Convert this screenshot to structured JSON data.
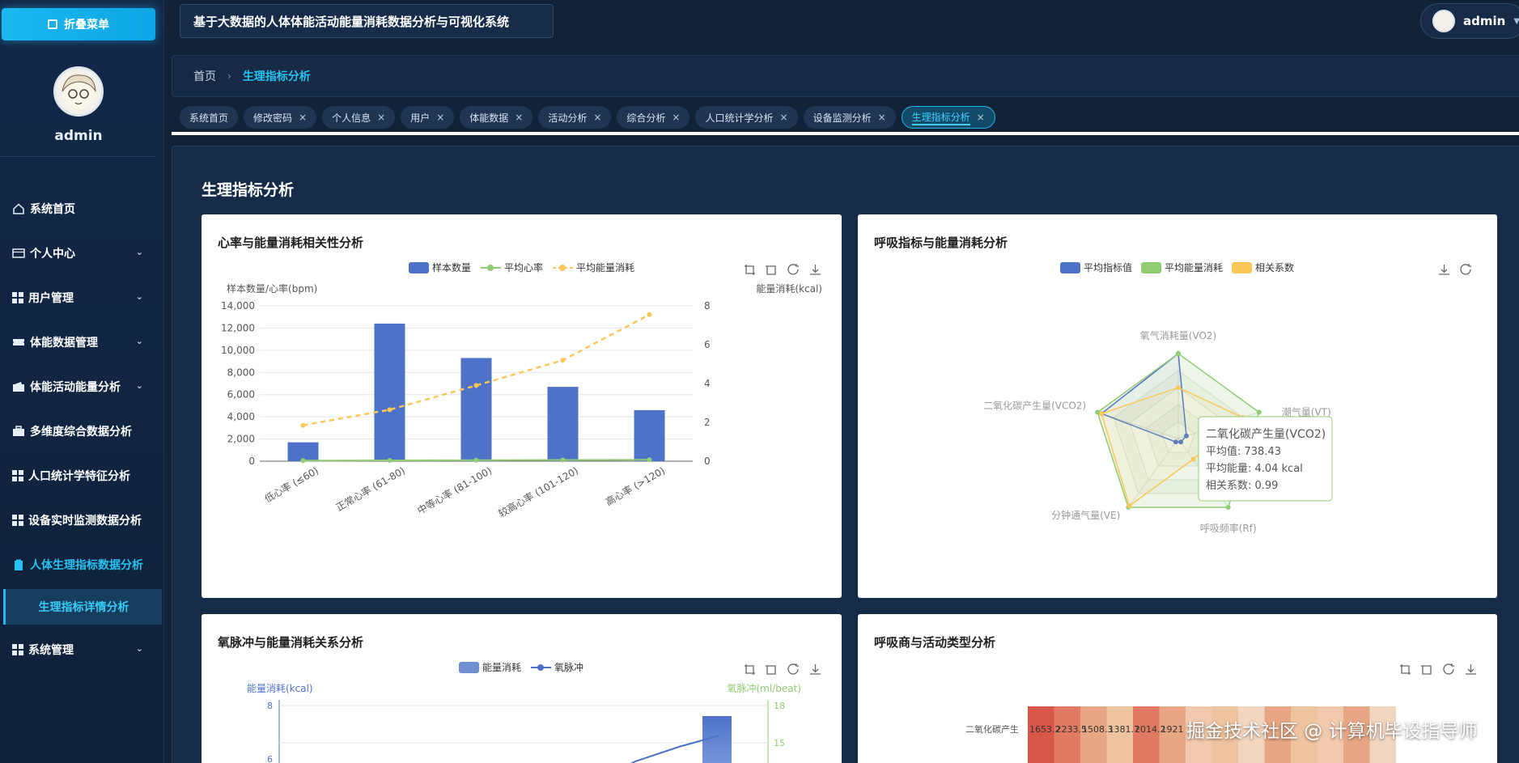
{
  "app": {
    "title": "基于大数据的人体体能活动能量消耗数据分析与可视化系统",
    "collapse_label": "折叠菜单",
    "user": "admin"
  },
  "sidebar": {
    "username": "admin",
    "items": [
      {
        "label": "系统首页",
        "icon": "home-icon"
      },
      {
        "label": "个人中心",
        "icon": "id-card-icon"
      },
      {
        "label": "用户管理",
        "icon": "grid-icon"
      },
      {
        "label": "体能数据管理",
        "icon": "ticket-icon"
      },
      {
        "label": "体能活动能量分析",
        "icon": "wallet-icon"
      },
      {
        "label": "多维度综合数据分析",
        "icon": "briefcase-icon"
      },
      {
        "label": "人口统计学特征分析",
        "icon": "grid-icon"
      },
      {
        "label": "设备实时监测数据分析",
        "icon": "grid-icon"
      },
      {
        "label": "人体生理指标数据分析",
        "icon": "clipboard-icon"
      },
      {
        "label": "系统管理",
        "icon": "grid-icon"
      }
    ],
    "submenu": "生理指标详情分析"
  },
  "breadcrumb": {
    "home": "首页",
    "current": "生理指标分析"
  },
  "tabs": [
    "系统首页",
    "修改密码",
    "个人信息",
    "用户",
    "体能数据",
    "活动分析",
    "综合分析",
    "人口统计学分析",
    "设备监测分析",
    "生理指标分析"
  ],
  "page_title": "生理指标分析",
  "colors": {
    "blue": "#4f72c9",
    "green": "#91cc75",
    "yellow": "#fac858",
    "accent": "#25c2f2"
  },
  "chart_data": [
    {
      "type": "bar",
      "title": "心率与能量消耗相关性分析",
      "categories": [
        "低心率 (≤60)",
        "正常心率 (61-80)",
        "中等心率 (81-100)",
        "较高心率 (101-120)",
        "高心率 (>120)"
      ],
      "ylabel": "样本数量/心率(bpm)",
      "ylabel_right": "能量消耗(kcal)",
      "ylim": [
        0,
        14000
      ],
      "ylim_right": [
        0,
        8
      ],
      "yticks": [
        "0",
        "2,000",
        "4,000",
        "6,000",
        "8,000",
        "10,000",
        "12,000",
        "14,000"
      ],
      "yticks_right": [
        "0",
        "2",
        "4",
        "6",
        "8"
      ],
      "legend": [
        "样本数量",
        "平均心率",
        "平均能量消耗"
      ],
      "series": [
        {
          "name": "样本数量",
          "type": "bar",
          "values": [
            1700,
            12400,
            9300,
            6700,
            4600
          ]
        },
        {
          "name": "平均心率",
          "type": "line",
          "values": [
            55,
            72,
            90,
            110,
            130
          ]
        },
        {
          "name": "平均能量消耗",
          "type": "line-dashed",
          "axis": "right",
          "values": [
            1.85,
            2.65,
            3.9,
            5.2,
            7.55
          ]
        }
      ]
    },
    {
      "type": "radar",
      "title": "呼吸指标与能量消耗分析",
      "legend": [
        "平均指标值",
        "平均能量消耗",
        "相关系数"
      ],
      "indicators": [
        "氧气消耗量(VO2)",
        "潮气量(VT)",
        "呼吸频率(Rf)",
        "分钟通气量(VE)",
        "二氧化碳产生量(VCO2)"
      ],
      "series": [
        {
          "name": "平均指标值",
          "values": [
            1.0,
            0.1,
            0.05,
            0.05,
            0.95
          ]
        },
        {
          "name": "平均能量消耗",
          "values": [
            1.0,
            1.0,
            1.0,
            1.0,
            1.0
          ]
        },
        {
          "name": "相关系数",
          "values": [
            0.6,
            0.8,
            0.3,
            0.98,
            0.95
          ]
        }
      ],
      "tooltip": {
        "title": "二氧化碳产生量(VCO2)",
        "line1": "平均值: 738.43",
        "line2": "平均能量: 4.04 kcal",
        "line3": "相关系数: 0.99"
      }
    },
    {
      "type": "bar",
      "title": "氧脉冲与能量消耗关系分析",
      "legend": [
        "能量消耗",
        "氧脉冲"
      ],
      "ylabel": "能量消耗(kcal)",
      "ylabel_right": "氧脉冲(ml/beat)",
      "yticks_visible": [
        "8",
        "6"
      ],
      "yticks_right_visible": [
        "18",
        "15"
      ]
    },
    {
      "type": "heatmap",
      "title": "呼吸商与活动类型分析",
      "row_label": "二氧化碳产生",
      "cells": [
        "1653.2",
        "2233.5",
        "1508.3",
        "1381.7",
        "2014.2",
        "1921"
      ]
    }
  ],
  "watermark": "掘金技术社区 @ 计算机毕设指导师"
}
